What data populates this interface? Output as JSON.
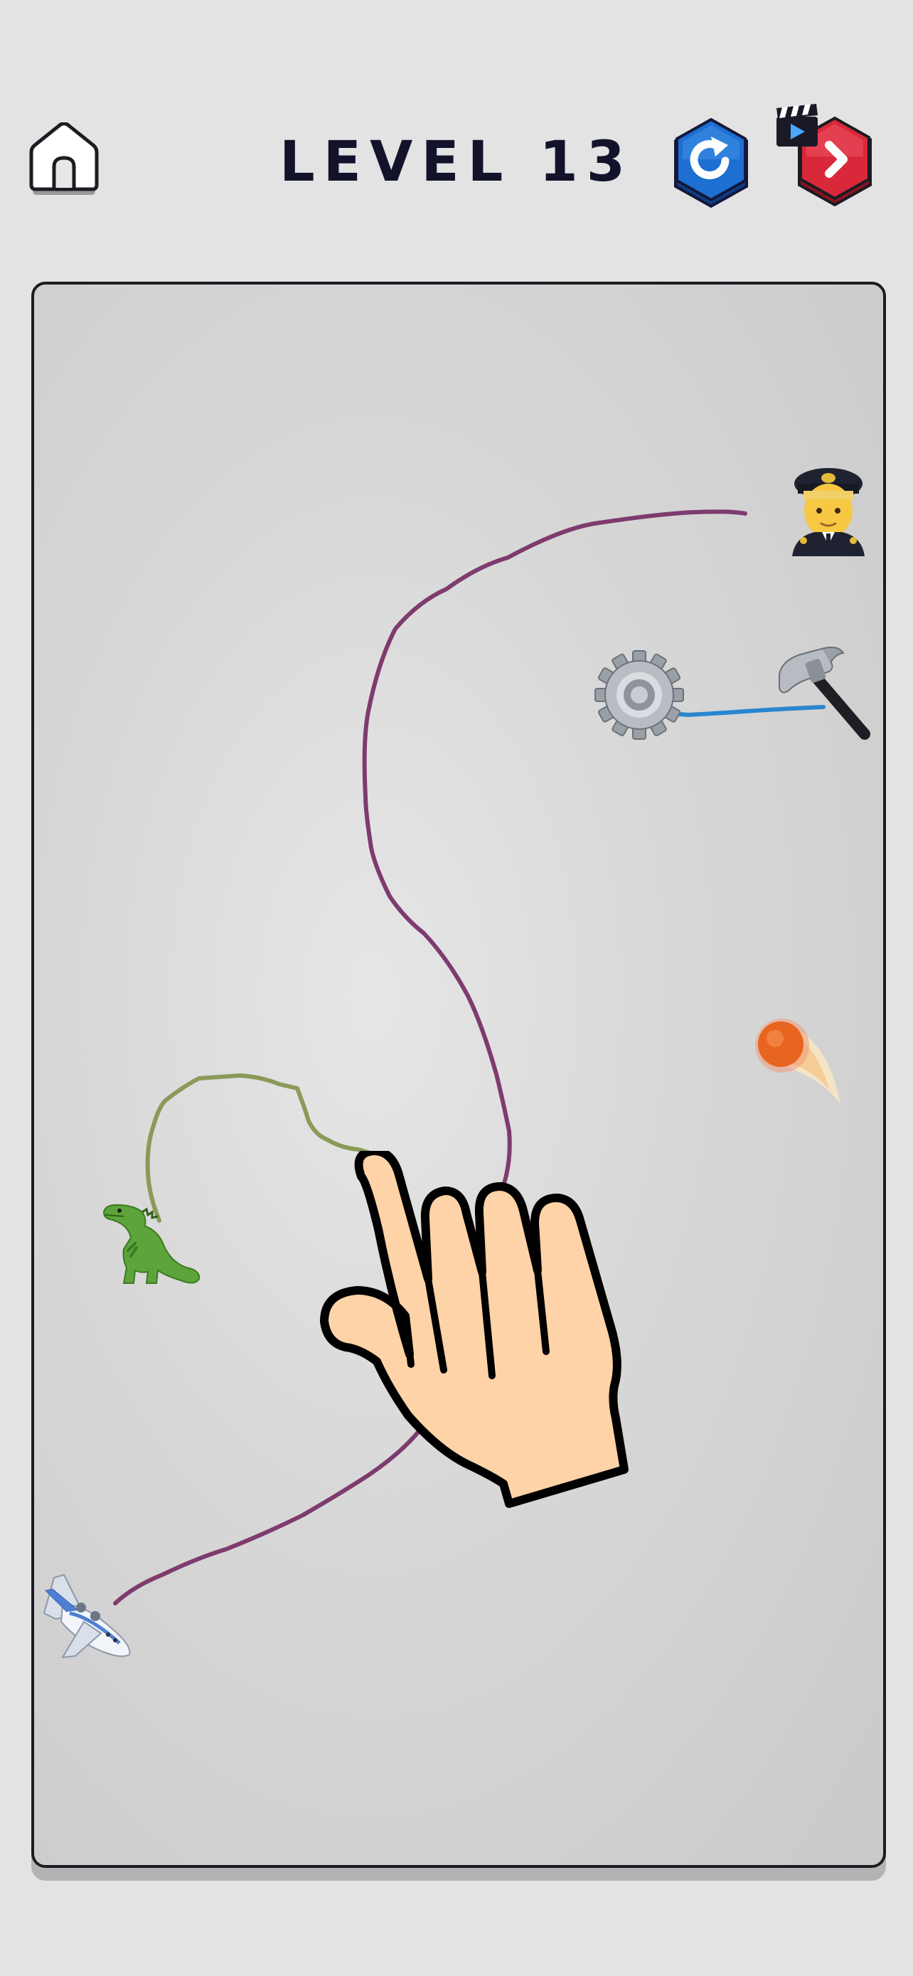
{
  "header": {
    "level_label": "LEVEL 13",
    "home_icon": "home-icon",
    "restart_icon": "restart-icon",
    "skip_icon": "skip-level-video-icon"
  },
  "board": {
    "items": [
      {
        "name": "pilot",
        "icon": "pilot-emoji"
      },
      {
        "name": "gear",
        "icon": "gear-emoji"
      },
      {
        "name": "hammer",
        "icon": "hammer-emoji"
      },
      {
        "name": "comet",
        "icon": "comet-emoji"
      },
      {
        "name": "dinosaur",
        "icon": "t-rex-emoji"
      },
      {
        "name": "airplane",
        "icon": "airplane-emoji"
      }
    ],
    "lines": [
      {
        "from": "airplane",
        "to": "pilot",
        "color": "#7e3b6e"
      },
      {
        "from": "hammer",
        "to": "gear",
        "color": "#2a86cf"
      },
      {
        "from": "dinosaur",
        "to": "",
        "color": "#8a9a58"
      }
    ],
    "tutorial_hand": "pointing-hand-icon"
  },
  "colors": {
    "background": "#e3e3e3",
    "title": "#12132b",
    "restart_button": "#1d6fd1",
    "skip_button": "#d8283a",
    "hand_fill": "#fdd3a7"
  }
}
